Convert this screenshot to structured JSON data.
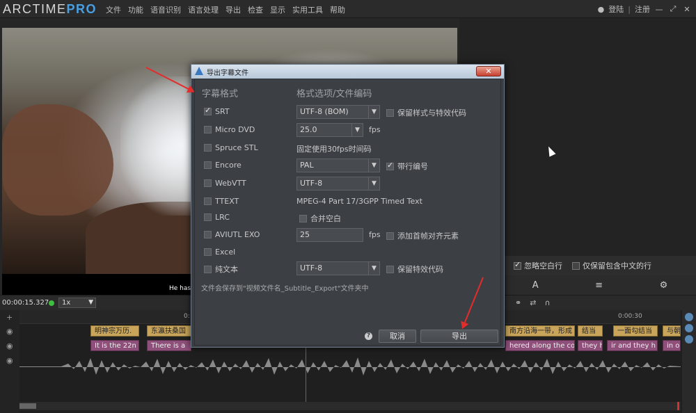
{
  "app": {
    "logo_main": "ARCTIME",
    "logo_pro": "PRO",
    "menu": [
      "文件",
      "功能",
      "语音识别",
      "语言处理",
      "导出",
      "检查",
      "显示",
      "实用工具",
      "帮助"
    ],
    "login": "登陆",
    "register": "注册",
    "sep": "|"
  },
  "video": {
    "subtitle": "He has"
  },
  "right_options": {
    "ignore_empty": "忽略空白行",
    "keep_chinese": "仅保留包含中文的行"
  },
  "timebar": {
    "timecode": "00:00:15.327",
    "speed": "1x"
  },
  "timeline": {
    "ruler_labels": [
      "0:",
      "0:00:30"
    ],
    "track1": [
      "明神宗万历.",
      "东瀛扶桑国",
      "南方沿海一带，形成",
      "结当",
      "一面勾结当",
      "与朝"
    ],
    "track2": [
      "It is the 22n",
      "There is a",
      "hered along the co",
      "they h",
      "ir and they h",
      "in o"
    ]
  },
  "dialog": {
    "title": "导出字幕文件",
    "close": "✕",
    "col_format": "字幕格式",
    "col_options": "格式选项/文件编码",
    "formats": {
      "srt": {
        "label": "SRT",
        "checked": true,
        "encoding": "UTF-8 (BOM)",
        "extra": "保留样式与特效代码"
      },
      "microdvd": {
        "label": "Micro DVD",
        "fps": "25.0",
        "unit": "fps"
      },
      "spruce": {
        "label": "Spruce STL",
        "text": "固定使用30fps时间码"
      },
      "encore": {
        "label": "Encore",
        "standard": "PAL",
        "extra": "带行编号",
        "extra_checked": true
      },
      "webvtt": {
        "label": "WebVTT",
        "encoding": "UTF-8"
      },
      "ttext": {
        "label": "TTEXT",
        "text": "MPEG-4 Part 17/3GPP Timed Text"
      },
      "lrc": {
        "label": "LRC",
        "extra": "合并空白"
      },
      "aviutl": {
        "label": "AVIUTL EXO",
        "fps": "25",
        "unit": "fps",
        "extra": "添加首帧对齐元素"
      },
      "excel": {
        "label": "Excel"
      },
      "plain": {
        "label": "纯文本",
        "encoding": "UTF-8",
        "extra": "保留特效代码"
      }
    },
    "note": "文件会保存到\"视频文件名_Subtitle_Export\"文件夹中",
    "help": "?",
    "cancel": "取消",
    "export": "导出"
  },
  "colors": {
    "accent": "#4a9fe0",
    "annotation_arrow": "#e52b2b",
    "playhead": "#dd3333"
  }
}
